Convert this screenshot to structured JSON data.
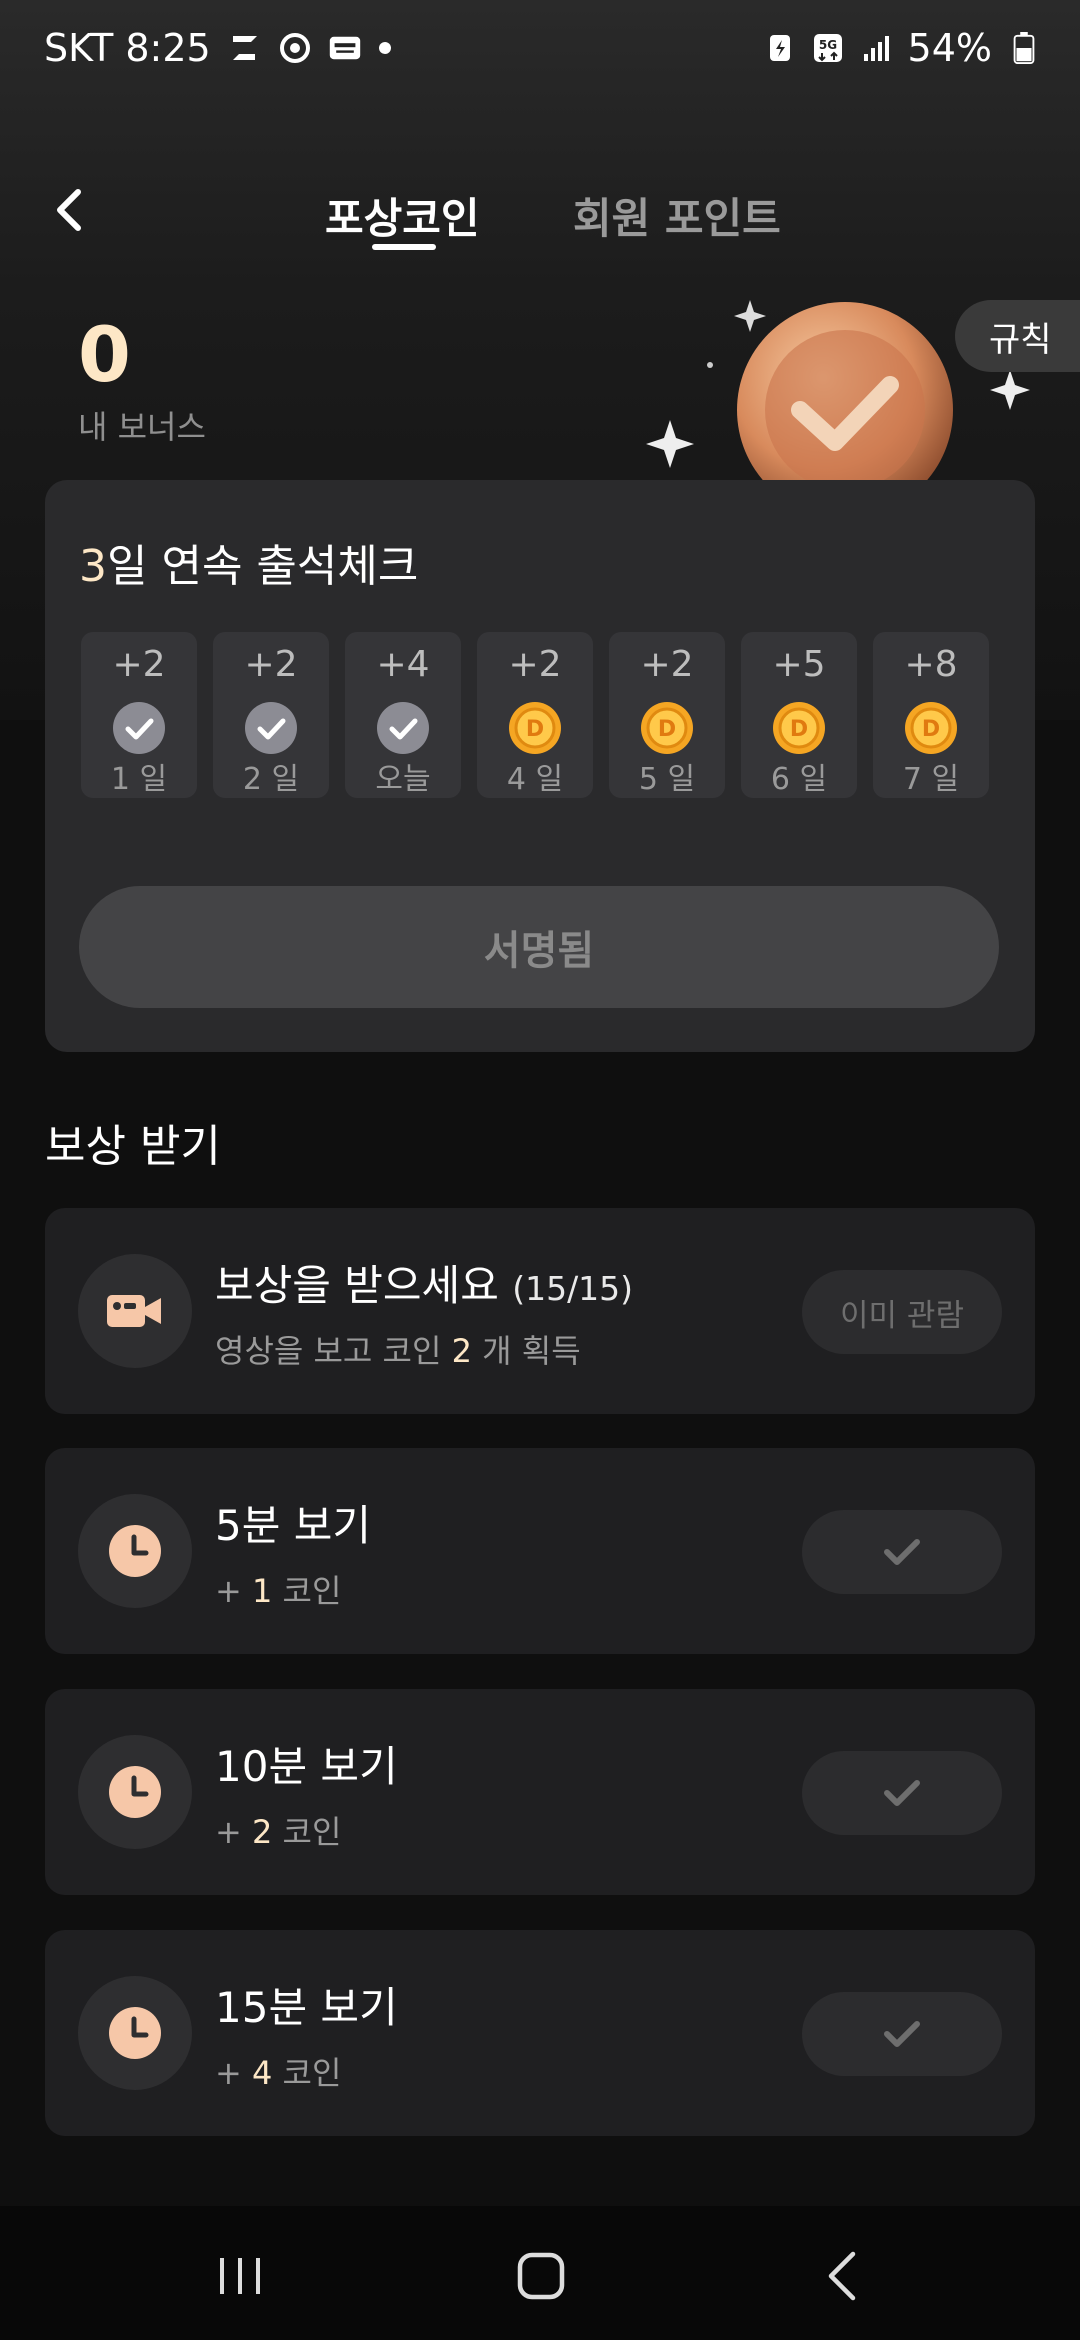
{
  "status_bar": {
    "carrier_time": "SKT 8:25",
    "battery": "54%"
  },
  "header": {
    "tab_reward_coin": "포상코인",
    "tab_member_points": "회원 포인트"
  },
  "bonus": {
    "value": "0",
    "label": "내 보너스",
    "rules_label": "규칙"
  },
  "attendance": {
    "title_highlight": "3",
    "title_rest": "일 연속 출석체크",
    "days": [
      {
        "points": "+2",
        "label": "1 일",
        "state": "checked"
      },
      {
        "points": "+2",
        "label": "2 일",
        "state": "checked"
      },
      {
        "points": "+4",
        "label": "오늘",
        "state": "checked"
      },
      {
        "points": "+2",
        "label": "4 일",
        "state": "coin"
      },
      {
        "points": "+2",
        "label": "5 일",
        "state": "coin"
      },
      {
        "points": "+5",
        "label": "6 일",
        "state": "coin"
      },
      {
        "points": "+8",
        "label": "7 일",
        "state": "coin"
      }
    ],
    "signed_label": "서명됨"
  },
  "rewards": {
    "section_title": "보상 받기",
    "items": [
      {
        "title": "보상을 받으세요",
        "count": "(15/15)",
        "sub_prefix": "영상을 보고 코인",
        "sub_amount": "2",
        "sub_suffix": "개 획득",
        "button": "이미 관람",
        "icon": "video-camera-icon"
      },
      {
        "title": "5분 보기",
        "sub_prefix": "+",
        "sub_amount": "1",
        "sub_suffix": "코인",
        "icon": "clock-icon"
      },
      {
        "title": "10분 보기",
        "sub_prefix": "+",
        "sub_amount": "2",
        "sub_suffix": "코인",
        "icon": "clock-icon"
      },
      {
        "title": "15분 보기",
        "sub_prefix": "+",
        "sub_amount": "4",
        "sub_suffix": "코인",
        "icon": "clock-icon"
      }
    ]
  },
  "colors": {
    "highlight": "#fde7c6",
    "card": "#2a2a2c",
    "coin": "#f5a623"
  }
}
